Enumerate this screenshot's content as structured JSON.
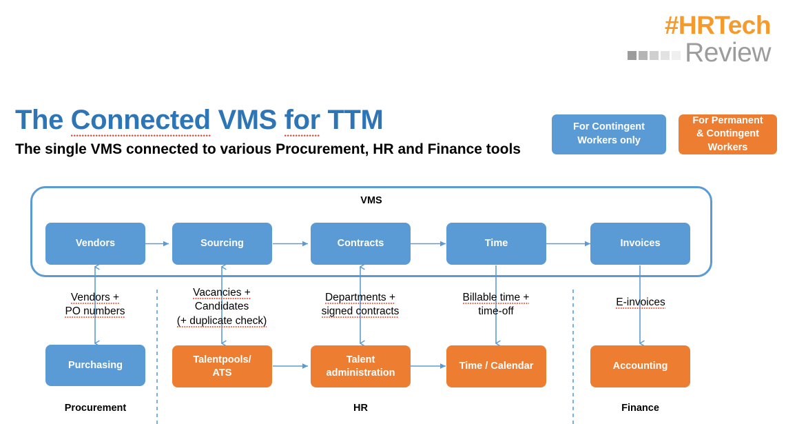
{
  "logo": {
    "line1": "#HRTech",
    "line2": "Review",
    "square_colors": [
      "#9C9C9C",
      "#B5B5B5",
      "#CFCFCF",
      "#E2E2E2",
      "#EFEFEF"
    ],
    "accent_color": "#F59B2E",
    "gray_color": "#9C9C9C"
  },
  "header": {
    "title_parts": [
      {
        "text": "The ",
        "spell": false
      },
      {
        "text": "Connected",
        "spell": true
      },
      {
        "text": " VMS ",
        "spell": false
      },
      {
        "text": "for",
        "spell": true
      },
      {
        "text": " TTM",
        "spell": false
      }
    ],
    "title_plain": "The Connected VMS for TTM",
    "subtitle": "The single VMS connected to various Procurement, HR and Finance tools",
    "title_color": "#2E75B6"
  },
  "legend": [
    {
      "label": "For Contingent Workers only",
      "lines": [
        "For Contingent",
        "Workers only"
      ],
      "color": "#5B9BD5",
      "style": "blue"
    },
    {
      "label": "For Permanent & Contingent Workers",
      "lines": [
        "For Permanent",
        "& Contingent",
        "Workers"
      ],
      "color": "#ED7D31",
      "style": "orange"
    }
  ],
  "diagram": {
    "container_label": "VMS",
    "container_color": "#5B9BD5",
    "blue": "#5B9BD5",
    "orange": "#ED7D31",
    "vms_nodes": [
      {
        "label": "Vendors"
      },
      {
        "label": "Sourcing"
      },
      {
        "label": "Contracts"
      },
      {
        "label": "Time"
      },
      {
        "label": "Invoices"
      }
    ],
    "tool_nodes": [
      {
        "label": "Purchasing",
        "color": "blue"
      },
      {
        "label": "Talentpools/ ATS",
        "lines": [
          "Talentpools/",
          "ATS"
        ],
        "color": "orange"
      },
      {
        "label": "Talent administration",
        "lines": [
          "Talent",
          "administration"
        ],
        "color": "orange"
      },
      {
        "label": "Time / Calendar",
        "lines": [
          "Time / Calendar"
        ],
        "color": "orange"
      },
      {
        "label": "Accounting",
        "lines": [
          "Accounting"
        ],
        "color": "orange"
      }
    ],
    "connector_labels": [
      {
        "lines": [
          "Vendors +",
          "PO numbers"
        ],
        "spell": [
          "Vendors",
          "numbers"
        ],
        "direction": "both"
      },
      {
        "lines": [
          "Vacancies +",
          "Candidates",
          "(+ duplicate check)"
        ],
        "spell": [
          "Vacancies",
          "duplicate"
        ],
        "direction": "both"
      },
      {
        "lines": [
          "Departments +",
          "signed contracts"
        ],
        "spell": [
          "Departments",
          "signed contracts"
        ],
        "direction": "both"
      },
      {
        "lines": [
          "Billable time +",
          "time-off"
        ],
        "spell": [
          "Billable"
        ],
        "direction": "down"
      },
      {
        "lines": [
          "E-invoices"
        ],
        "spell": [
          "E-invoices"
        ],
        "direction": "down"
      }
    ],
    "section_labels": [
      "Procurement",
      "HR",
      "Finance"
    ]
  }
}
